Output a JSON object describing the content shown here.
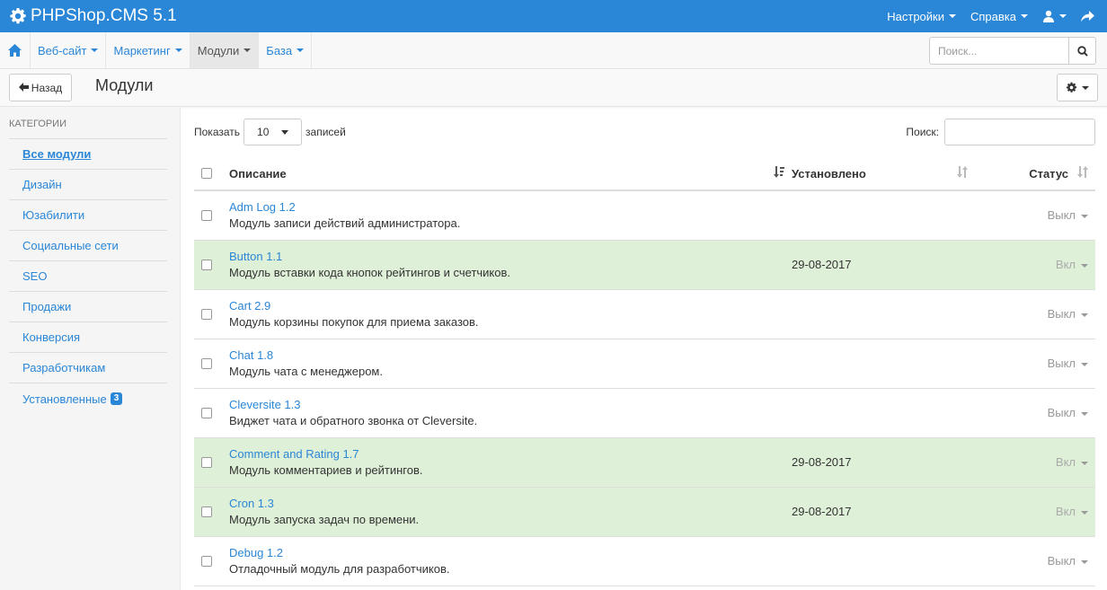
{
  "app": {
    "title": "PHPShop.CMS 5.1"
  },
  "topmenu": {
    "settings": "Настройки",
    "help": "Справка"
  },
  "nav": {
    "items": [
      {
        "label": "Веб-сайт"
      },
      {
        "label": "Маркетинг"
      },
      {
        "label": "Модули"
      },
      {
        "label": "База"
      }
    ],
    "search_placeholder": "Поиск..."
  },
  "toolbar": {
    "back_label": "Назад",
    "page_title": "Модули"
  },
  "sidebar": {
    "title": "КАТЕГОРИИ",
    "items": [
      {
        "label": "Все модули"
      },
      {
        "label": "Дизайн"
      },
      {
        "label": "Юзабилити"
      },
      {
        "label": "Социальные сети"
      },
      {
        "label": "SEO"
      },
      {
        "label": "Продажи"
      },
      {
        "label": "Конверсия"
      },
      {
        "label": "Разработчикам"
      },
      {
        "label": "Установленные",
        "badge": "3"
      }
    ]
  },
  "table_controls": {
    "show_label": "Показать",
    "page_length": "10",
    "entries_label": "записей",
    "search_label": "Поиск:"
  },
  "table": {
    "columns": {
      "description": "Описание",
      "installed": "Установлено",
      "status": "Статус"
    },
    "rows": [
      {
        "name": "Adm Log 1.2",
        "description": "Модуль записи действий администратора.",
        "installed": "",
        "status": "Выкл"
      },
      {
        "name": "Button 1.1",
        "description": "Модуль вставки кода кнопок рейтингов и счетчиков.",
        "installed": "29-08-2017",
        "status": "Вкл"
      },
      {
        "name": "Cart 2.9",
        "description": "Модуль корзины покупок для приема заказов.",
        "installed": "",
        "status": "Выкл"
      },
      {
        "name": "Chat 1.8",
        "description": "Модуль чата с менеджером.",
        "installed": "",
        "status": "Выкл"
      },
      {
        "name": "Cleversite 1.3",
        "description": "Виджет чата и обратного звонка от Cleversite.",
        "installed": "",
        "status": "Выкл"
      },
      {
        "name": "Comment and Rating 1.7",
        "description": "Модуль комментариев и рейтингов.",
        "installed": "29-08-2017",
        "status": "Вкл"
      },
      {
        "name": "Cron 1.3",
        "description": "Модуль запуска задач по времени.",
        "installed": "29-08-2017",
        "status": "Вкл"
      },
      {
        "name": "Debug 1.2",
        "description": "Отладочный модуль для разработчиков.",
        "installed": "",
        "status": "Выкл"
      }
    ]
  },
  "colors": {
    "accent": "#2a86d6",
    "installed_row": "#dff0d8"
  }
}
